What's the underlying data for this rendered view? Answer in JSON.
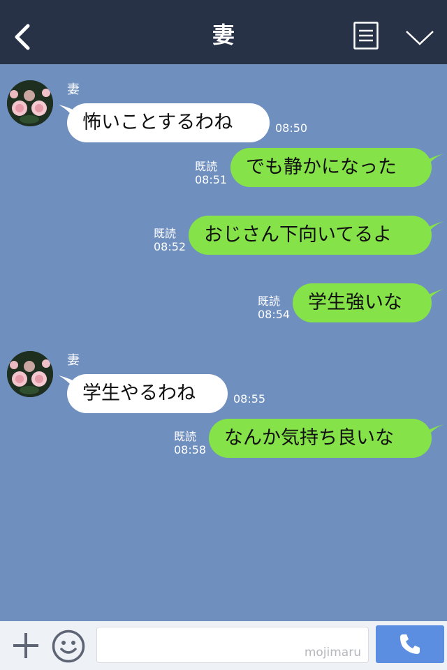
{
  "header": {
    "title": "妻",
    "back_icon": "back-chevron-icon",
    "menu_icon": "menu-list-icon",
    "expand_icon": "chevron-down-icon"
  },
  "messages": [
    {
      "side": "left",
      "sender": "妻",
      "text": "怖いことするわね",
      "time": "08:50"
    },
    {
      "side": "right",
      "read": "既読",
      "text": "でも静かになった",
      "time": "08:51"
    },
    {
      "side": "right",
      "read": "既読",
      "text": "おじさん下向いてるよ",
      "time": "08:52"
    },
    {
      "side": "right",
      "read": "既読",
      "text": "学生強いな",
      "time": "08:54"
    },
    {
      "side": "left",
      "sender": "妻",
      "text": "学生やるわね",
      "time": "08:55"
    },
    {
      "side": "right",
      "read": "既読",
      "text": "なんか気持ち良いな",
      "time": "08:58"
    }
  ],
  "footer": {
    "plus_icon": "plus-icon",
    "emoji_icon": "emoji-icon",
    "input_value": "",
    "watermark": "mojimaru",
    "call_icon": "phone-icon"
  },
  "colors": {
    "header_bg": "#273246",
    "chat_bg": "#6f8fbf",
    "incoming_bubble": "#ffffff",
    "outgoing_bubble": "#85e249",
    "call_button": "#5b8de0"
  }
}
